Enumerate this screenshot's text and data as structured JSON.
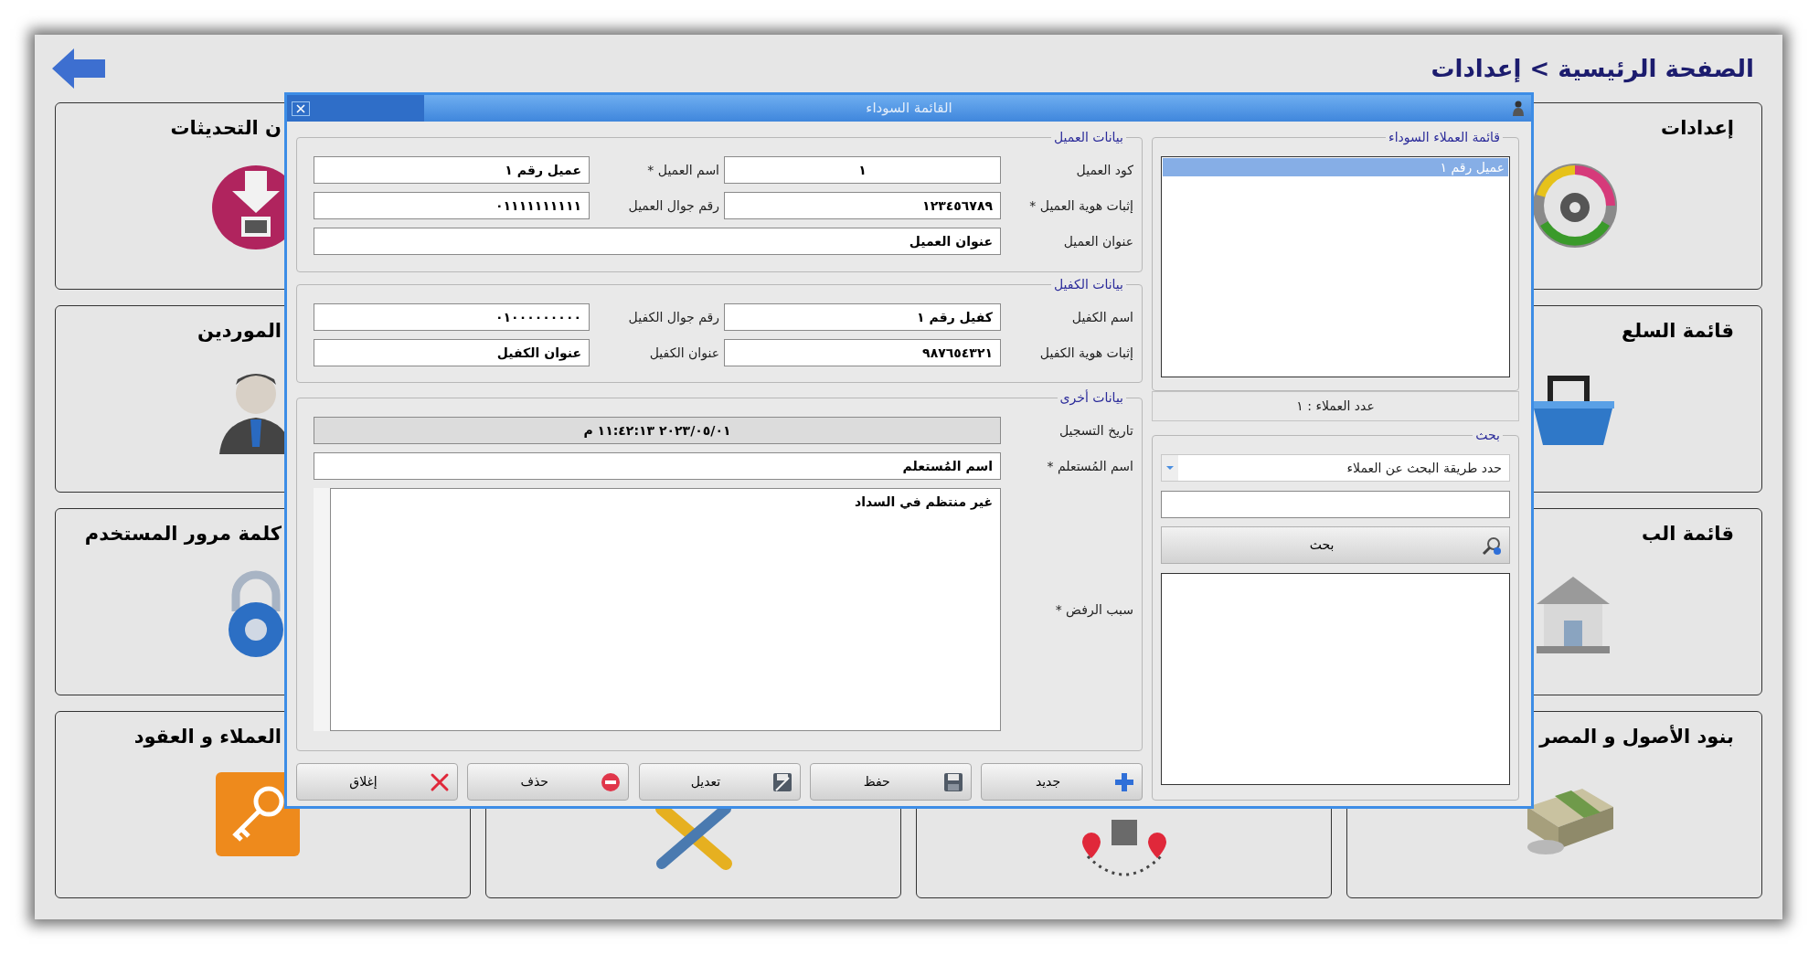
{
  "breadcrumb": "الصفحة الرئيسية > إعدادات",
  "tiles": [
    {
      "title": "إعدادات"
    },
    {
      "title": "ن التحديثات"
    },
    {
      "title": "قائمة السلع"
    },
    {
      "title": "الموردين"
    },
    {
      "title": "قائمة الب"
    },
    {
      "title": "كلمة مرور المستخدم"
    },
    {
      "title": "بنود الأصول و المصر"
    },
    {
      "title": "العملاء و العقود"
    }
  ],
  "dialog": {
    "title": "القائمة السوداء",
    "customer_group": {
      "title": "بيانات العميل",
      "fields": [
        {
          "label": "كود العميل",
          "value": "١"
        },
        {
          "label": "اسم العميل *",
          "value": "عميل رقم ١"
        },
        {
          "label": "إثبات هوية العميل *",
          "value": "١٢٣٤٥٦٧٨٩"
        },
        {
          "label": "رقم جوال العميل",
          "value": "٠١١١١١١١١١١"
        }
      ],
      "address": {
        "label": "عنوان العميل",
        "value": "عنوان العميل"
      }
    },
    "guarantor_group": {
      "title": "بيانات الكفيل",
      "fields": [
        {
          "label": "اسم الكفيل",
          "value": "كفيل رقم ١"
        },
        {
          "label": "رقم جوال الكفيل",
          "value": "٠١٠٠٠٠٠٠٠٠٠"
        },
        {
          "label": "إثبات هوية الكفيل",
          "value": "٩٨٧٦٥٤٣٢١"
        },
        {
          "label": "عنوان الكفيل",
          "value": "عنوان الكفيل"
        }
      ]
    },
    "other_group": {
      "title": "بيانات أخرى",
      "registration_date": {
        "label": "تاريخ التسجيل",
        "value": "٢٠٢٣/٠٥/٠١ ١١:٤٢:١٣ م"
      },
      "user_name": {
        "label": "اسم المُستعلم *",
        "value": "اسم المُستعلم"
      },
      "reason": {
        "label": "سبب الرفض *",
        "value": "غير منتظم في السداد"
      }
    },
    "buttons": [
      {
        "label": "جديد"
      },
      {
        "label": "حفظ"
      },
      {
        "label": "تعديل"
      },
      {
        "label": "حذف"
      },
      {
        "label": "إغلاق"
      }
    ],
    "blacklist": {
      "title": "قائمة العملاء السوداء",
      "items": [
        {
          "label": "عميل رقم ١",
          "selected": true
        }
      ],
      "count": "عدد العملاء : ١"
    },
    "search": {
      "title": "بحث",
      "method": "حدد طريقة البحث عن العملاء",
      "button": "بحث"
    }
  }
}
